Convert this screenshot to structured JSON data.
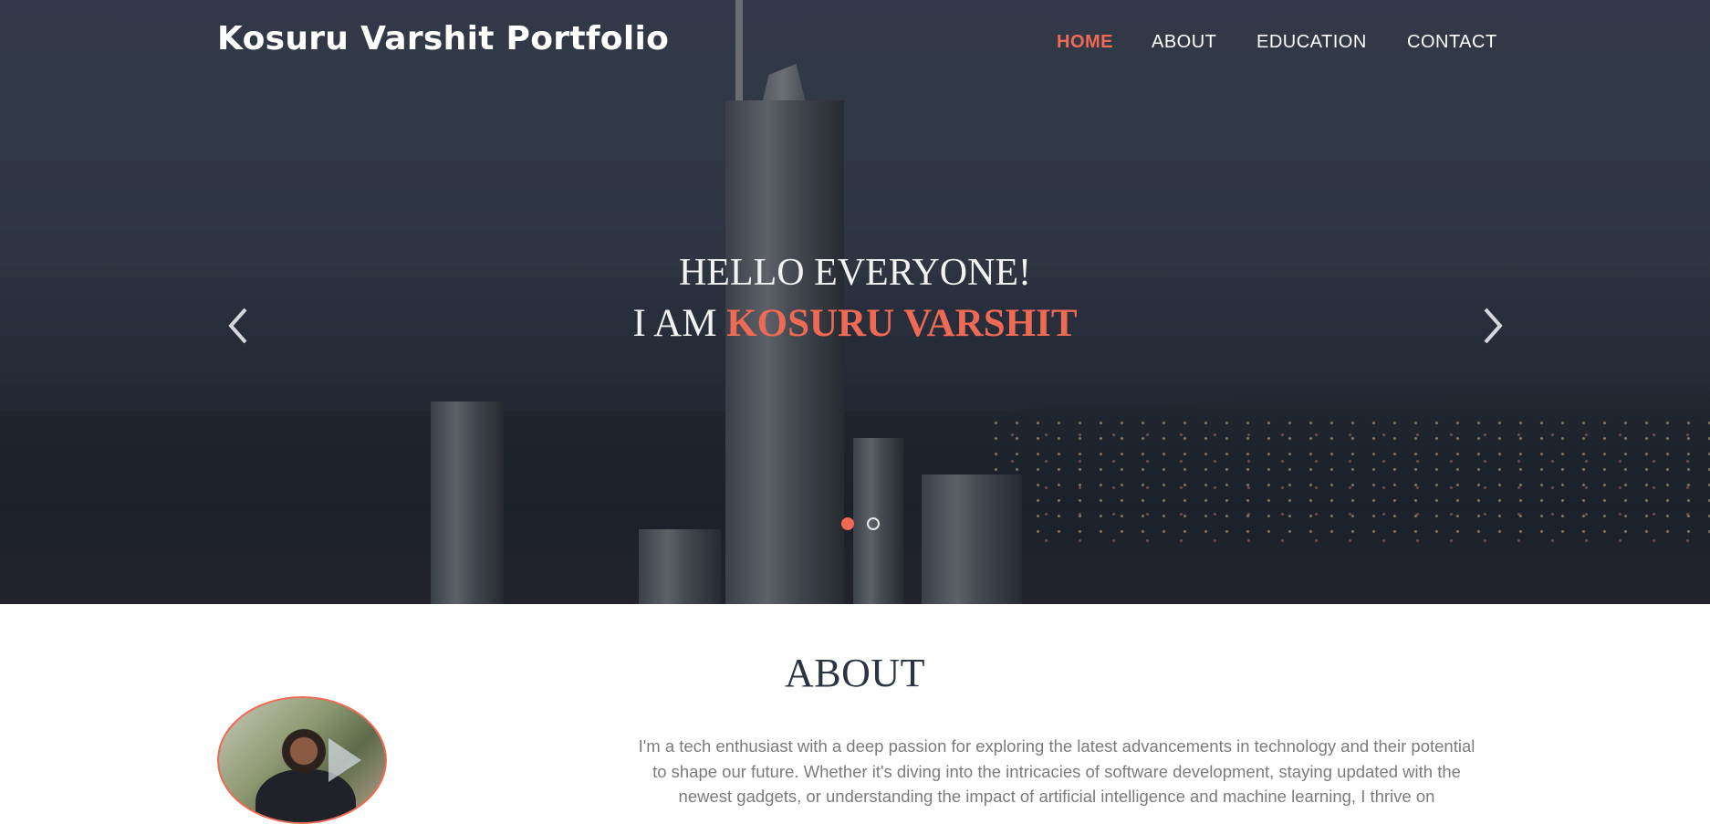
{
  "header": {
    "brand": "Kosuru Varshit Portfolio",
    "nav": [
      {
        "label": "HOME",
        "active": true
      },
      {
        "label": "ABOUT",
        "active": false
      },
      {
        "label": "EDUCATION",
        "active": false
      },
      {
        "label": "CONTACT",
        "active": false
      }
    ]
  },
  "hero": {
    "line1": "HELLO EVERYONE!",
    "line2_prefix": "I AM ",
    "line2_name": "KOSURU VARSHIT",
    "prev_icon": "chevron-left-icon",
    "next_icon": "chevron-right-icon",
    "slides": 2,
    "active_slide": 1
  },
  "about": {
    "title": "ABOUT",
    "text": "I'm a tech enthusiast with a deep passion for exploring the latest advancements in technology and their potential to shape our future. Whether it's diving into the intricacies of software development, staying updated with the newest gadgets, or understanding the impact of artificial intelligence and machine learning, I thrive on"
  },
  "colors": {
    "accent": "#ee6a55",
    "heading": "#2c3444",
    "body_text": "#7b7b7b"
  }
}
